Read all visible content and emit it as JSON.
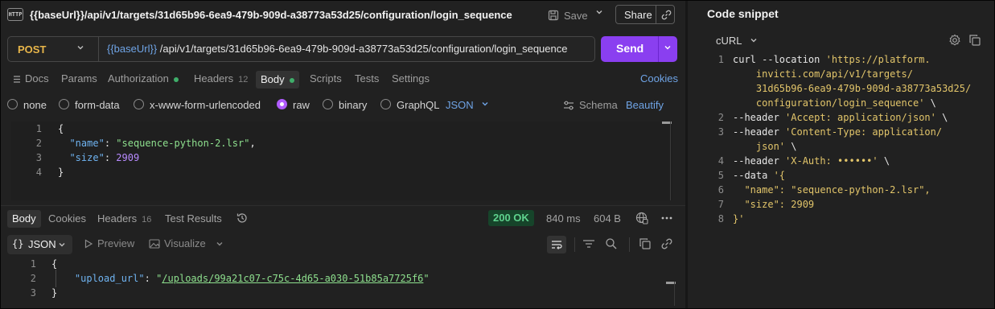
{
  "header": {
    "http_badge": "HTTP",
    "title": "{{baseUrl}}/api/v1/targets/31d65b96-6ea9-479b-909d-a38773a53d25/configuration/login_sequence",
    "save_label": "Save",
    "share_label": "Share"
  },
  "request": {
    "method": "POST",
    "url_variable": "{{baseUrl}}",
    "url_path": "/api/v1/targets/31d65b96-6ea9-479b-909d-a38773a53d25/configuration/login_sequence",
    "send_label": "Send",
    "tabs": {
      "docs": "Docs",
      "params": "Params",
      "authorization": "Authorization",
      "headers": "Headers",
      "headers_count": "12",
      "body": "Body",
      "scripts": "Scripts",
      "tests": "Tests",
      "settings": "Settings"
    },
    "cookies_label": "Cookies",
    "body_modes": {
      "none": "none",
      "form_data": "form-data",
      "urlencoded": "x-www-form-urlencoded",
      "raw": "raw",
      "binary": "binary",
      "graphql": "GraphQL"
    },
    "selected_mode": "raw",
    "content_type": "JSON",
    "schema_label": "Schema",
    "beautify_label": "Beautify",
    "body_lines": [
      "{",
      "  \"name\": \"sequence-python-2.lsr\",",
      "  \"size\": 2909",
      "}"
    ],
    "body_name_value": "\"sequence-python-2.lsr\"",
    "body_size_value": "2909"
  },
  "response": {
    "tabs": {
      "body": "Body",
      "cookies": "Cookies",
      "headers": "Headers",
      "headers_count": "16",
      "test_results": "Test Results"
    },
    "status": "200 OK",
    "time": "840 ms",
    "size": "604 B",
    "format": "JSON",
    "preview_label": "Preview",
    "visualize_label": "Visualize",
    "upload_url_value": "/uploads/99a21c07-c75c-4d65-a030-51b85a7725f6"
  },
  "snippet": {
    "title": "Code snippet",
    "language": "cURL",
    "lines": [
      {
        "n": "1",
        "segments": [
          [
            "plain",
            "curl --location "
          ],
          [
            "str",
            "'https://platform."
          ]
        ]
      },
      {
        "n": "",
        "segments": [
          [
            "str",
            "    invicti.com/api/v1/targets/"
          ]
        ]
      },
      {
        "n": "",
        "segments": [
          [
            "str",
            "    31d65b96-6ea9-479b-909d-a38773a53d25/"
          ]
        ]
      },
      {
        "n": "",
        "segments": [
          [
            "str",
            "    configuration/login_sequence'"
          ],
          [
            "plain",
            " \\"
          ]
        ]
      },
      {
        "n": "2",
        "segments": [
          [
            "plain",
            "--header "
          ],
          [
            "str",
            "'Accept: application/json'"
          ],
          [
            "plain",
            " \\"
          ]
        ]
      },
      {
        "n": "3",
        "segments": [
          [
            "plain",
            "--header "
          ],
          [
            "str",
            "'Content-Type: application/"
          ]
        ]
      },
      {
        "n": "",
        "segments": [
          [
            "str",
            "    json'"
          ],
          [
            "plain",
            " \\"
          ]
        ]
      },
      {
        "n": "4",
        "segments": [
          [
            "plain",
            "--header "
          ],
          [
            "str",
            "'X-Auth: ••••••'"
          ],
          [
            "plain",
            " \\"
          ]
        ]
      },
      {
        "n": "5",
        "segments": [
          [
            "plain",
            "--data "
          ],
          [
            "str",
            "'{"
          ]
        ]
      },
      {
        "n": "6",
        "segments": [
          [
            "str",
            "  \"name\": \"sequence-python-2.lsr\","
          ]
        ]
      },
      {
        "n": "7",
        "segments": [
          [
            "str",
            "  \"size\": 2909"
          ]
        ]
      },
      {
        "n": "8",
        "segments": [
          [
            "str",
            "}'"
          ]
        ]
      }
    ]
  }
}
